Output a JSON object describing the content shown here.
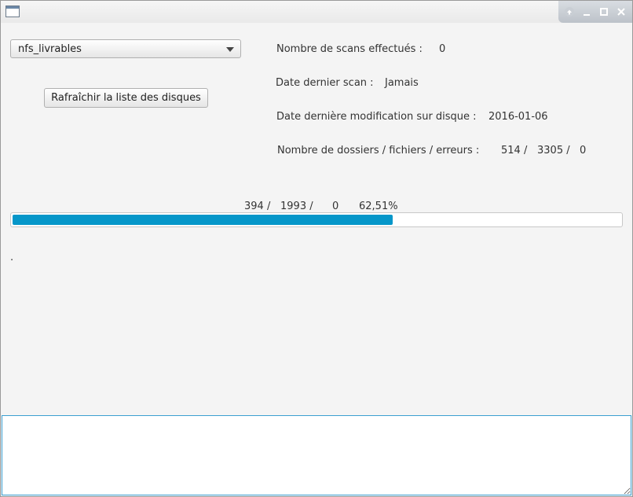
{
  "window": {
    "title": ""
  },
  "disk_select": {
    "value": "nfs_livrables"
  },
  "refresh_button": {
    "label": "Rafraîchir la liste des disques"
  },
  "info": {
    "scans_label": "Nombre de scans effectués :",
    "scans_value": "0",
    "last_scan_label": "Date dernier scan :",
    "last_scan_value": "Jamais",
    "last_modif_label": "Date dernière modification sur disque :",
    "last_modif_value": "2016-01-06",
    "counts_label": "Nombre de dossiers / fichiers / erreurs :",
    "counts_folders": "514 /",
    "counts_files": "3305 /",
    "counts_errors": "0"
  },
  "progress": {
    "done": "394 /",
    "total": "1993 /",
    "errors": "0",
    "percent_text": "62,51%",
    "fraction": 0.6251
  },
  "status_text": ".",
  "log": {
    "value": ""
  },
  "colors": {
    "progress": "#0596c9",
    "focus_border": "#3b9fd1"
  },
  "icons": {
    "app": "window-icon",
    "controls": [
      "restore-icon",
      "minimize-icon",
      "maximize-icon",
      "close-icon"
    ]
  }
}
